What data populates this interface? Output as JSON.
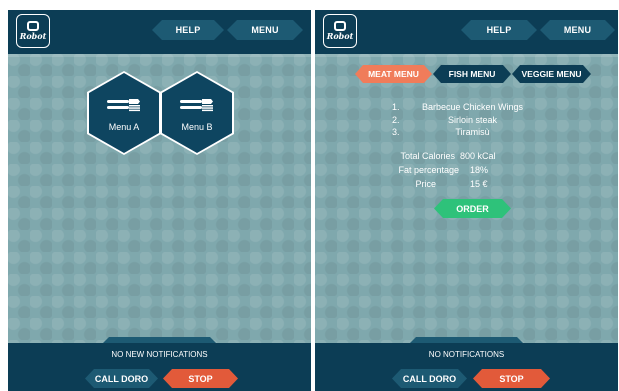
{
  "brand": {
    "logo_text": "Robot"
  },
  "header": {
    "help_label": "HELP",
    "menu_label": "MENU"
  },
  "left_screen": {
    "menus": [
      {
        "label": "Menu A",
        "icon": "cutlery-icon"
      },
      {
        "label": "Menu B",
        "icon": "cutlery-icon"
      }
    ],
    "notification": "NO NEW NOTIFICATIONS"
  },
  "right_screen": {
    "tabs": [
      {
        "label": "MEAT MENU",
        "active": true
      },
      {
        "label": "FISH MENU",
        "active": false
      },
      {
        "label": "VEGGIE MENU",
        "active": false
      }
    ],
    "dishes": [
      {
        "number": "1.",
        "name": "Barbecue Chicken Wings"
      },
      {
        "number": "2.",
        "name": "Sirloin steak"
      },
      {
        "number": "3.",
        "name": "Tiramisù"
      }
    ],
    "stats": {
      "calories_label": "Total Calories",
      "calories_value": "800 kCal",
      "fat_label": "Fat percentage",
      "fat_value": "18%",
      "price_label": "Price",
      "price_value": "15 €"
    },
    "order_label": "ORDER",
    "notification": "NO NOTIFICATIONS"
  },
  "footer": {
    "call_label": "CALL DORO",
    "stop_label": "STOP"
  },
  "colors": {
    "bar": "#0c3d55",
    "button": "#1d5a73",
    "active_tab": "#f07c5a",
    "order": "#2ec27a",
    "stop": "#e25a3a",
    "background": "#7fa8ad"
  }
}
